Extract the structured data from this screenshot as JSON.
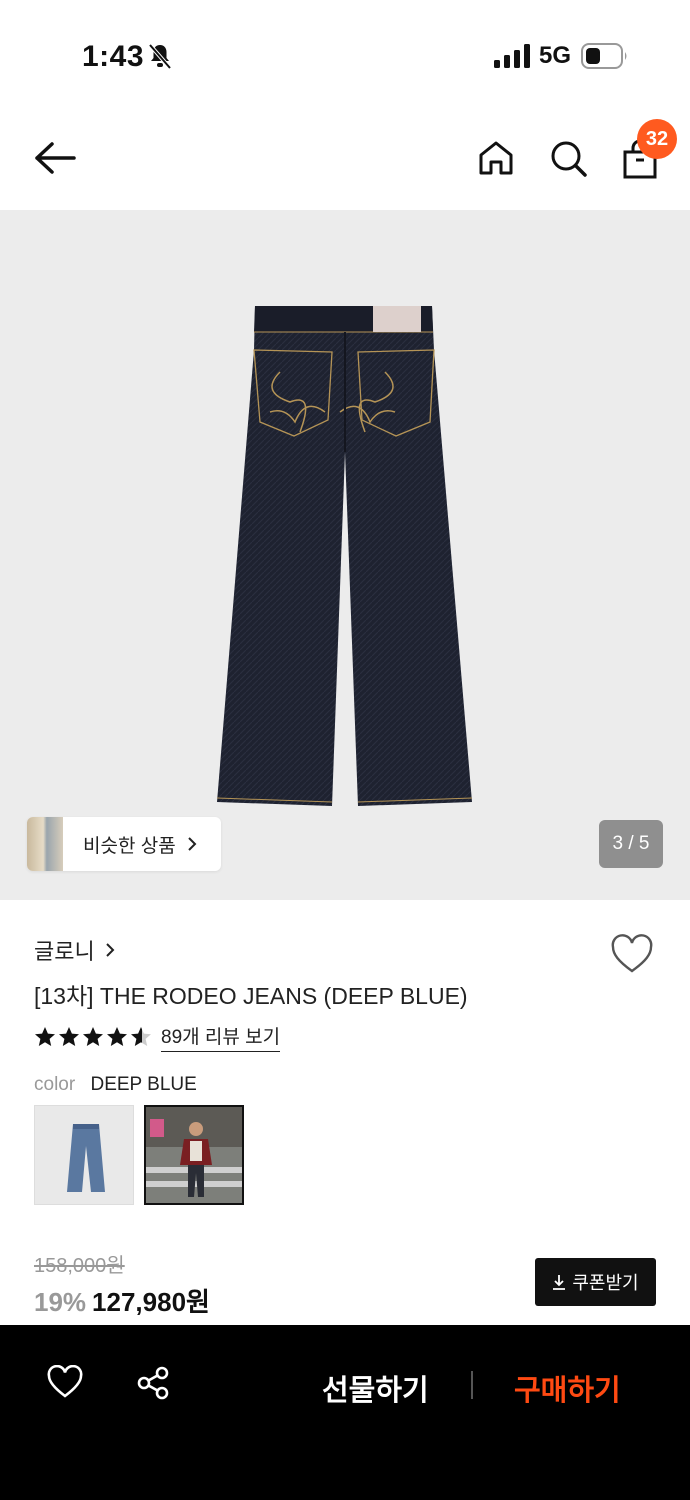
{
  "status": {
    "time": "1:43",
    "network": "5G"
  },
  "header": {
    "cart_count": "32"
  },
  "gallery": {
    "similar_label": "비슷한 상품",
    "page_indicator": "3 / 5"
  },
  "product": {
    "brand": "글로니",
    "title": "[13차] THE RODEO JEANS (DEEP BLUE)",
    "rating": 4.5,
    "review_link": "89개 리뷰 보기",
    "color_label": "color",
    "color_value": "DEEP BLUE",
    "original_price": "158,000원",
    "discount": "19%",
    "price": "127,980원",
    "coupon_label": "쿠폰받기"
  },
  "bottom_bar": {
    "gift_label": "선물하기",
    "buy_label": "구매하기"
  },
  "colors": {
    "accent": "#ff4a12",
    "badge": "#ff5a1f",
    "denim": "#1f2230",
    "stitch": "#b59456"
  }
}
